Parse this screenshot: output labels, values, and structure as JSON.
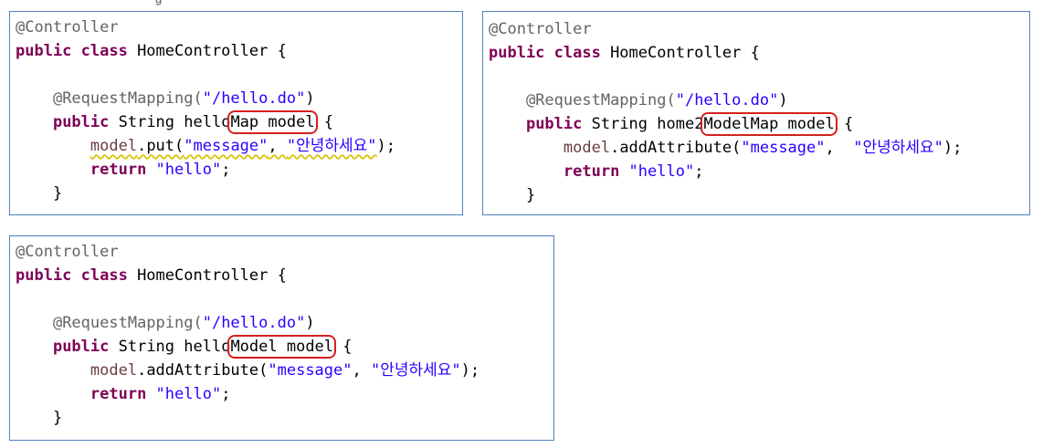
{
  "top_fragment": "g",
  "panels": [
    {
      "lines": {
        "l1": "@Controller",
        "l2_kw": "public class",
        "l2_name": " HomeController {",
        "l3": "",
        "l4_ann": "@RequestMapping(",
        "l4_str": "\"/hello.do\"",
        "l4_end": ")",
        "l5_kw": "public",
        "l5_type": " String hello",
        "l5_param": "Map model",
        "l5_end": " {",
        "l6_var": "model",
        "l6_call": ".put(",
        "l6_str1": "\"message\"",
        "l6_sep": ", ",
        "l6_str2": "\"안녕하세요\"",
        "l6_end": ");",
        "l7_kw": "return",
        "l7_str": " \"hello\"",
        "l7_end": ";",
        "l8": "}"
      }
    },
    {
      "lines": {
        "l1": "@Controller",
        "l2_kw": "public class",
        "l2_name": " HomeController {",
        "l3": "",
        "l4_ann": "@RequestMapping(",
        "l4_str": "\"/hello.do\"",
        "l4_end": ")",
        "l5_kw": "public",
        "l5_type": " String home2",
        "l5_param": "ModelMap model",
        "l5_end": " {",
        "l6_var": "model",
        "l6_call": ".addAttribute(",
        "l6_str1": "\"message\"",
        "l6_sep": ",  ",
        "l6_str2": "\"안녕하세요\"",
        "l6_end": ");",
        "l7_kw": "return",
        "l7_str": " \"hello\"",
        "l7_end": ";",
        "l8": "}"
      }
    },
    {
      "lines": {
        "l1": "@Controller",
        "l2_kw": "public class",
        "l2_name": " HomeController {",
        "l3": "",
        "l4_ann": "@RequestMapping(",
        "l4_str": "\"/hello.do\"",
        "l4_end": ")",
        "l5_kw": "public",
        "l5_type": " String hello",
        "l5_param": "Model model",
        "l5_end": " {",
        "l6_var": "model",
        "l6_call": ".addAttribute(",
        "l6_str1": "\"message\"",
        "l6_sep": ", ",
        "l6_str2": "\"안녕하세요\"",
        "l6_end": ");",
        "l7_kw": "return",
        "l7_str": " \"hello\"",
        "l7_end": ";",
        "l8": "}"
      }
    }
  ],
  "colors": {
    "panel_border": "#4f81bd",
    "highlight_box": "#d62020",
    "keyword": "#7f0055",
    "string": "#2a00ff",
    "annotation": "#646464"
  }
}
